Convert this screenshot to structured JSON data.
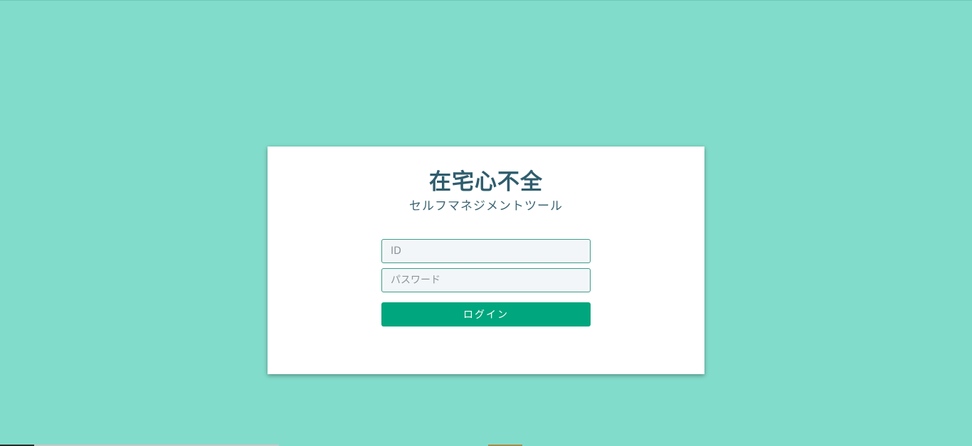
{
  "app": {
    "title": "在宅心不全",
    "subtitle": "セルフマネジメントツール"
  },
  "login_form": {
    "id_placeholder": "ID",
    "id_value": "",
    "password_placeholder": "パスワード",
    "password_value": "",
    "login_label": "ログイン"
  },
  "colors": {
    "background": "#82dccb",
    "card": "#ffffff",
    "title": "#2f5d6e",
    "button": "#00a67d",
    "field_border": "#3f9c8a"
  }
}
